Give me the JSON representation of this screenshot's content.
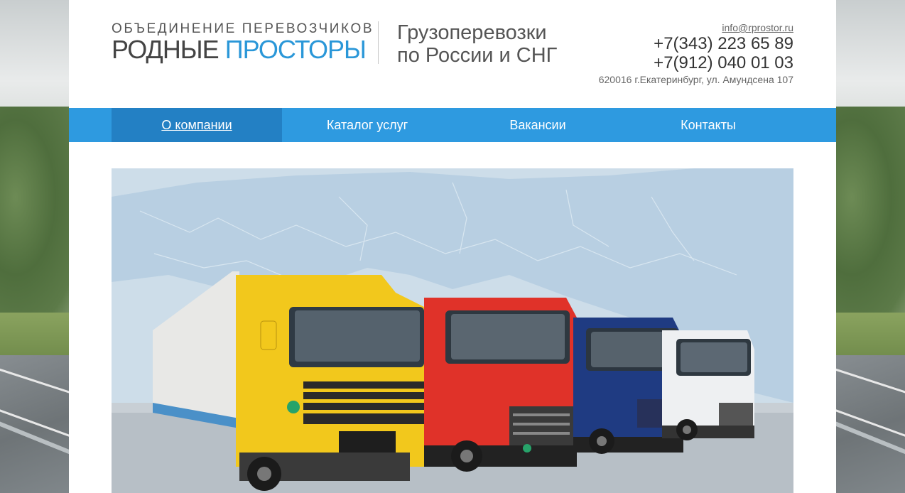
{
  "header": {
    "logo_top": "ОБЪЕДИНЕНИЕ ПЕРЕВОЗЧИКОВ",
    "logo_main_part1": "РОДНЫЕ",
    "logo_main_part2": "ПРОСТОРЫ",
    "tagline_line1": "Грузоперевозки",
    "tagline_line2": "по России и СНГ",
    "email": "info@rprostor.ru",
    "phones": [
      "+7(343) 223 65 89",
      "+7(912) 040 01 03"
    ],
    "address": "620016 г.Екатеринбург, ул. Амундсена 107"
  },
  "nav": {
    "items": [
      {
        "label": "О компании",
        "active": true
      },
      {
        "label": "Каталог услуг",
        "active": false
      },
      {
        "label": "Вакансии",
        "active": false
      },
      {
        "label": "Контакты",
        "active": false
      }
    ]
  },
  "colors": {
    "accent": "#2a97d8",
    "nav_bg": "#2e9ae0",
    "nav_active": "#2380c4"
  }
}
